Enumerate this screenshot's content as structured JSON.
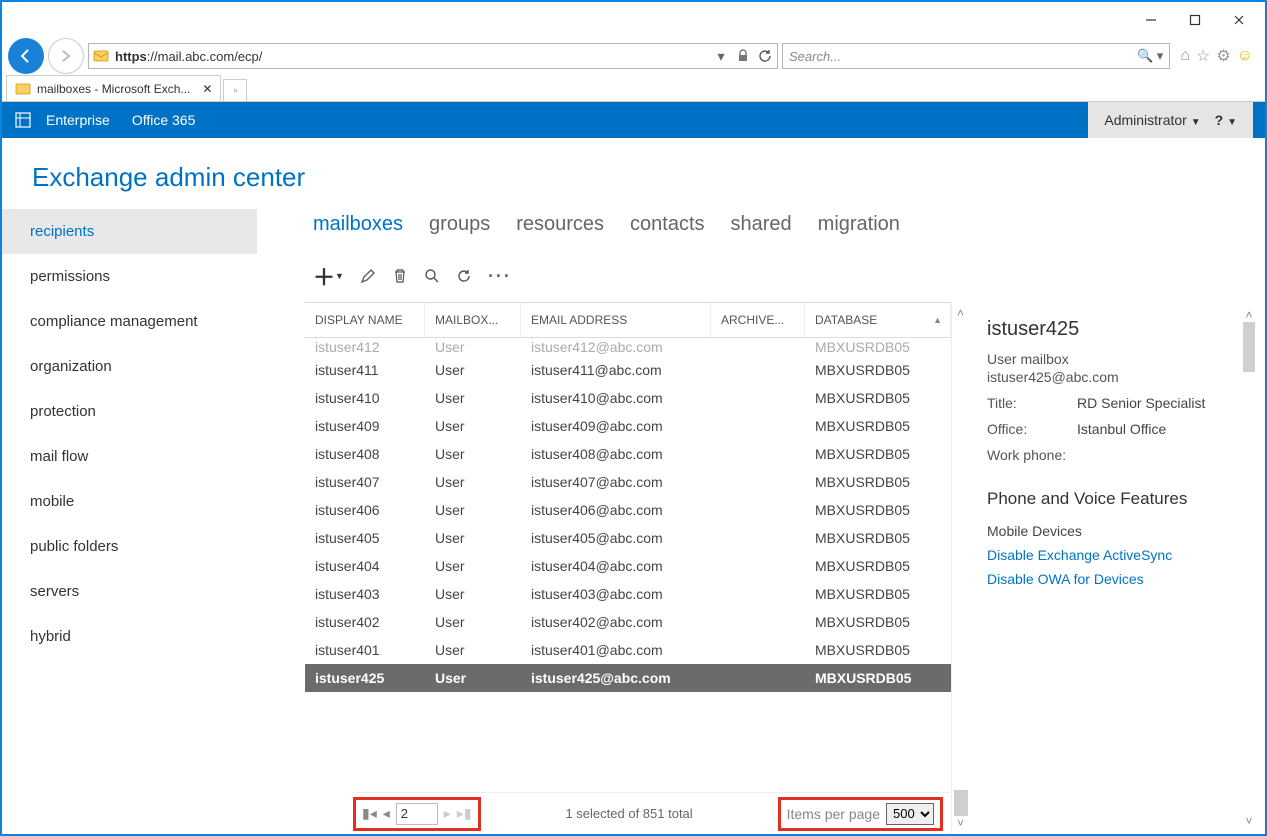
{
  "browser": {
    "url": "https://mail.abc.com/ecp/",
    "url_prefix": "https",
    "url_suffix": "://mail.abc.com/ecp/",
    "search_placeholder": "Search...",
    "tab_title": "mailboxes - Microsoft Exch..."
  },
  "header": {
    "enterprise": "Enterprise",
    "o365": "Office 365",
    "admin": "Administrator",
    "help": "?"
  },
  "page_title": "Exchange admin center",
  "sidebar": {
    "items": [
      "recipients",
      "permissions",
      "compliance management",
      "organization",
      "protection",
      "mail flow",
      "mobile",
      "public folders",
      "servers",
      "hybrid"
    ]
  },
  "subtabs": [
    "mailboxes",
    "groups",
    "resources",
    "contacts",
    "shared",
    "migration"
  ],
  "columns": {
    "name": "DISPLAY NAME",
    "type": "MAILBOX...",
    "email": "EMAIL ADDRESS",
    "archive": "ARCHIVE...",
    "db": "DATABASE"
  },
  "cutrow": {
    "name": "istuser412",
    "type": "User",
    "email": "istuser412@abc.com",
    "db": "MBXUSRDB05"
  },
  "rows": [
    {
      "name": "istuser411",
      "type": "User",
      "email": "istuser411@abc.com",
      "db": "MBXUSRDB05"
    },
    {
      "name": "istuser410",
      "type": "User",
      "email": "istuser410@abc.com",
      "db": "MBXUSRDB05"
    },
    {
      "name": "istuser409",
      "type": "User",
      "email": "istuser409@abc.com",
      "db": "MBXUSRDB05"
    },
    {
      "name": "istuser408",
      "type": "User",
      "email": "istuser408@abc.com",
      "db": "MBXUSRDB05"
    },
    {
      "name": "istuser407",
      "type": "User",
      "email": "istuser407@abc.com",
      "db": "MBXUSRDB05"
    },
    {
      "name": "istuser406",
      "type": "User",
      "email": "istuser406@abc.com",
      "db": "MBXUSRDB05"
    },
    {
      "name": "istuser405",
      "type": "User",
      "email": "istuser405@abc.com",
      "db": "MBXUSRDB05"
    },
    {
      "name": "istuser404",
      "type": "User",
      "email": "istuser404@abc.com",
      "db": "MBXUSRDB05"
    },
    {
      "name": "istuser403",
      "type": "User",
      "email": "istuser403@abc.com",
      "db": "MBXUSRDB05"
    },
    {
      "name": "istuser402",
      "type": "User",
      "email": "istuser402@abc.com",
      "db": "MBXUSRDB05"
    },
    {
      "name": "istuser401",
      "type": "User",
      "email": "istuser401@abc.com",
      "db": "MBXUSRDB05"
    }
  ],
  "selrow": {
    "name": "istuser425",
    "type": "User",
    "email": "istuser425@abc.com",
    "db": "MBXUSRDB05"
  },
  "pager": {
    "page": "2",
    "summary": "1 selected of 851 total",
    "ipp_label": "Items per page",
    "ipp_value": "500"
  },
  "details": {
    "title": "istuser425",
    "subtype": "User mailbox",
    "email": "istuser425@abc.com",
    "title_label": "Title:",
    "title_val": "RD Senior Specialist",
    "office_label": "Office:",
    "office_val": "Istanbul Office",
    "phone_label": "Work phone:",
    "section": "Phone and Voice Features",
    "mobile_label": "Mobile Devices",
    "link1": "Disable Exchange ActiveSync",
    "link2": "Disable OWA for Devices"
  }
}
